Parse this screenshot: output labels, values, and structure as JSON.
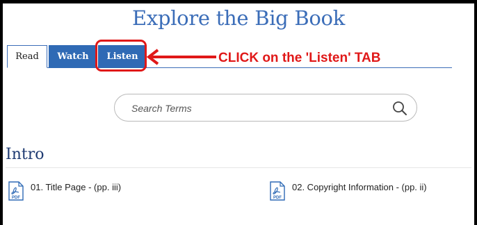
{
  "page": {
    "title": "Explore the Big Book"
  },
  "tabs": [
    {
      "label": "Read",
      "active": true
    },
    {
      "label": "Watch",
      "active": false
    },
    {
      "label": "Listen",
      "active": false
    }
  ],
  "annotation": {
    "callout": "CLICK on the 'Listen' TAB",
    "color": "#e01818"
  },
  "search": {
    "placeholder": "Search Terms"
  },
  "section": {
    "title": "Intro",
    "documents": [
      {
        "label": "01. Title Page - (pp. iii)",
        "icon": "pdf-icon"
      },
      {
        "label": "02. Copyright Information - (pp. ii)",
        "icon": "pdf-icon"
      }
    ]
  },
  "colors": {
    "brand": "#3b6db8",
    "tab_bg": "#2f6ab5",
    "heading": "#1f3b72"
  }
}
